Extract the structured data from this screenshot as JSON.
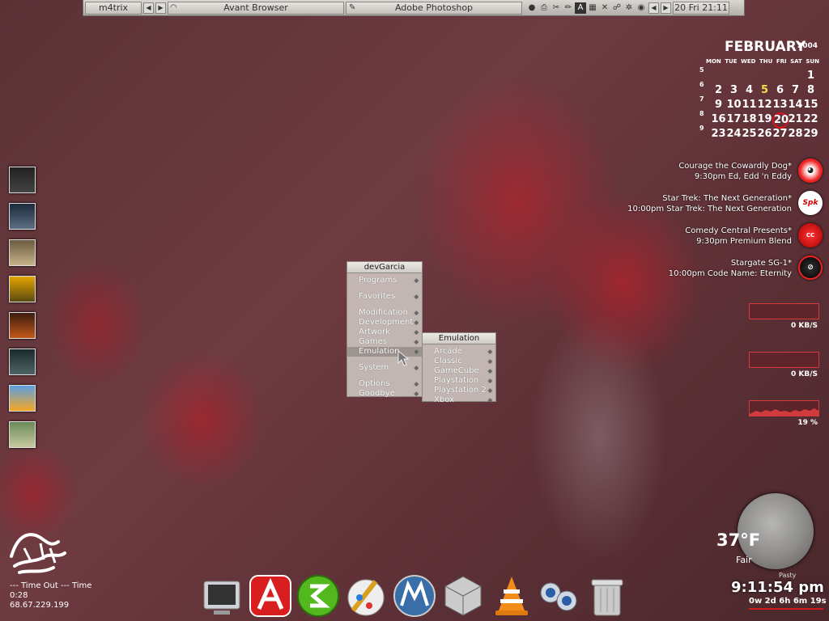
{
  "taskbar": {
    "user": "m4trix",
    "task1": "Avant Browser",
    "task2": "Adobe Photoshop",
    "clock": "20 Fri 21:11",
    "tray_icons": [
      "globe-icon",
      "printer-icon",
      "tools-icon",
      "pen-icon",
      "app-icon",
      "grid-icon",
      "x-icon",
      "network-icon",
      "gear-icon",
      "disc-icon"
    ]
  },
  "calendar": {
    "month": "FEBRUARY",
    "year": "2004",
    "days": [
      "MON",
      "TUE",
      "WED",
      "THU",
      "FRI",
      "SAT",
      "SUN"
    ],
    "weeks": [
      {
        "wk": "5",
        "dates": [
          "",
          "",
          "",
          "",
          "",
          "",
          "1"
        ]
      },
      {
        "wk": "6",
        "dates": [
          "2",
          "3",
          "4",
          "5",
          "6",
          "7",
          "8"
        ]
      },
      {
        "wk": "7",
        "dates": [
          "9",
          "10",
          "11",
          "12",
          "13",
          "14",
          "15"
        ]
      },
      {
        "wk": "8",
        "dates": [
          "16",
          "17",
          "18",
          "19",
          "20",
          "21",
          "22"
        ]
      },
      {
        "wk": "9",
        "dates": [
          "23",
          "24",
          "25",
          "26",
          "27",
          "28",
          "29"
        ]
      }
    ],
    "highlight": "5",
    "today": "20",
    "colors": {
      "highlight": "#f2e04a",
      "today": "#e0121c"
    }
  },
  "shows": [
    {
      "title": "Courage the Cowardly Dog*",
      "detail": "9:30pm Ed, Edd 'n Eddy",
      "logo": "courage-logo"
    },
    {
      "title": "Star Trek: The Next Generation*",
      "detail": "10:00pm Star Trek: The Next Generation",
      "logo": "spike-logo"
    },
    {
      "title": "Comedy Central Presents*",
      "detail": "9:30pm Premium Blend",
      "logo": "comedy-central-logo"
    },
    {
      "title": "Stargate SG-1*",
      "detail": "10:00pm Code Name: Eternity",
      "logo": "scifi-logo"
    }
  ],
  "meters": [
    {
      "label": "0 KB/S",
      "level": 0
    },
    {
      "label": "0 KB/S",
      "level": 0
    },
    {
      "label": "19 %",
      "level": 0.19
    }
  ],
  "menu": {
    "title": "devGarcia",
    "items": [
      {
        "label": "Programs",
        "gap_after": true
      },
      {
        "label": "Favorites",
        "gap_after": true
      },
      {
        "label": "Modification",
        "gap_after": false
      },
      {
        "label": "Development",
        "gap_after": false
      },
      {
        "label": "Artwork",
        "gap_after": false
      },
      {
        "label": "Games",
        "gap_after": false
      },
      {
        "label": "Emulation",
        "gap_after": true,
        "active": true
      },
      {
        "label": "System",
        "gap_after": true
      },
      {
        "label": "Options",
        "gap_after": false
      },
      {
        "label": "Goodbye",
        "gap_after": false
      }
    ]
  },
  "submenu": {
    "title": "Emulation",
    "items": [
      "Arcade",
      "Classic",
      "GameCube",
      "Playstation",
      "Playstation 2",
      "Xbox"
    ]
  },
  "weather": {
    "temp": "37°F",
    "condition": "Fair",
    "location": "Pasty"
  },
  "clock": {
    "time": "9:11:54 pm",
    "uptime": "0w 2d 6h 6m 19s"
  },
  "info": {
    "line1": "---  Time Out   ---   Time",
    "line2": "0:28",
    "line3": "68.67.229.199"
  },
  "left_dock": [
    "dvd-icon",
    "matrix-icon",
    "winamp-icon",
    "half-life-icon",
    "game-icon",
    "movie-icon",
    "naruto-icon",
    "photo-icon"
  ],
  "bottom_dock": [
    "monitor-icon",
    "acrobat-icon",
    "3ds-icon",
    "paint-icon",
    "maya-icon",
    "cube-icon",
    "vlc-icon",
    "messenger-icon",
    "trash-icon"
  ]
}
